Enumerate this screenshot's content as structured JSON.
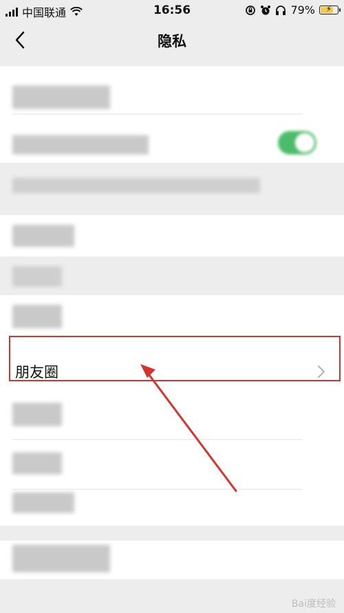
{
  "status_bar": {
    "carrier": "中国联通",
    "time": "16:56",
    "battery_percent": "79%"
  },
  "nav": {
    "title": "隐私"
  },
  "list": {
    "moments_label": "朋友圈"
  },
  "colors": {
    "background": "#ededed",
    "highlight_border": "#d9322b",
    "toggle_green": "#4cbc6a",
    "battery_fill": "#f2c94c"
  },
  "watermark": {
    "text": "Bai度经验"
  }
}
